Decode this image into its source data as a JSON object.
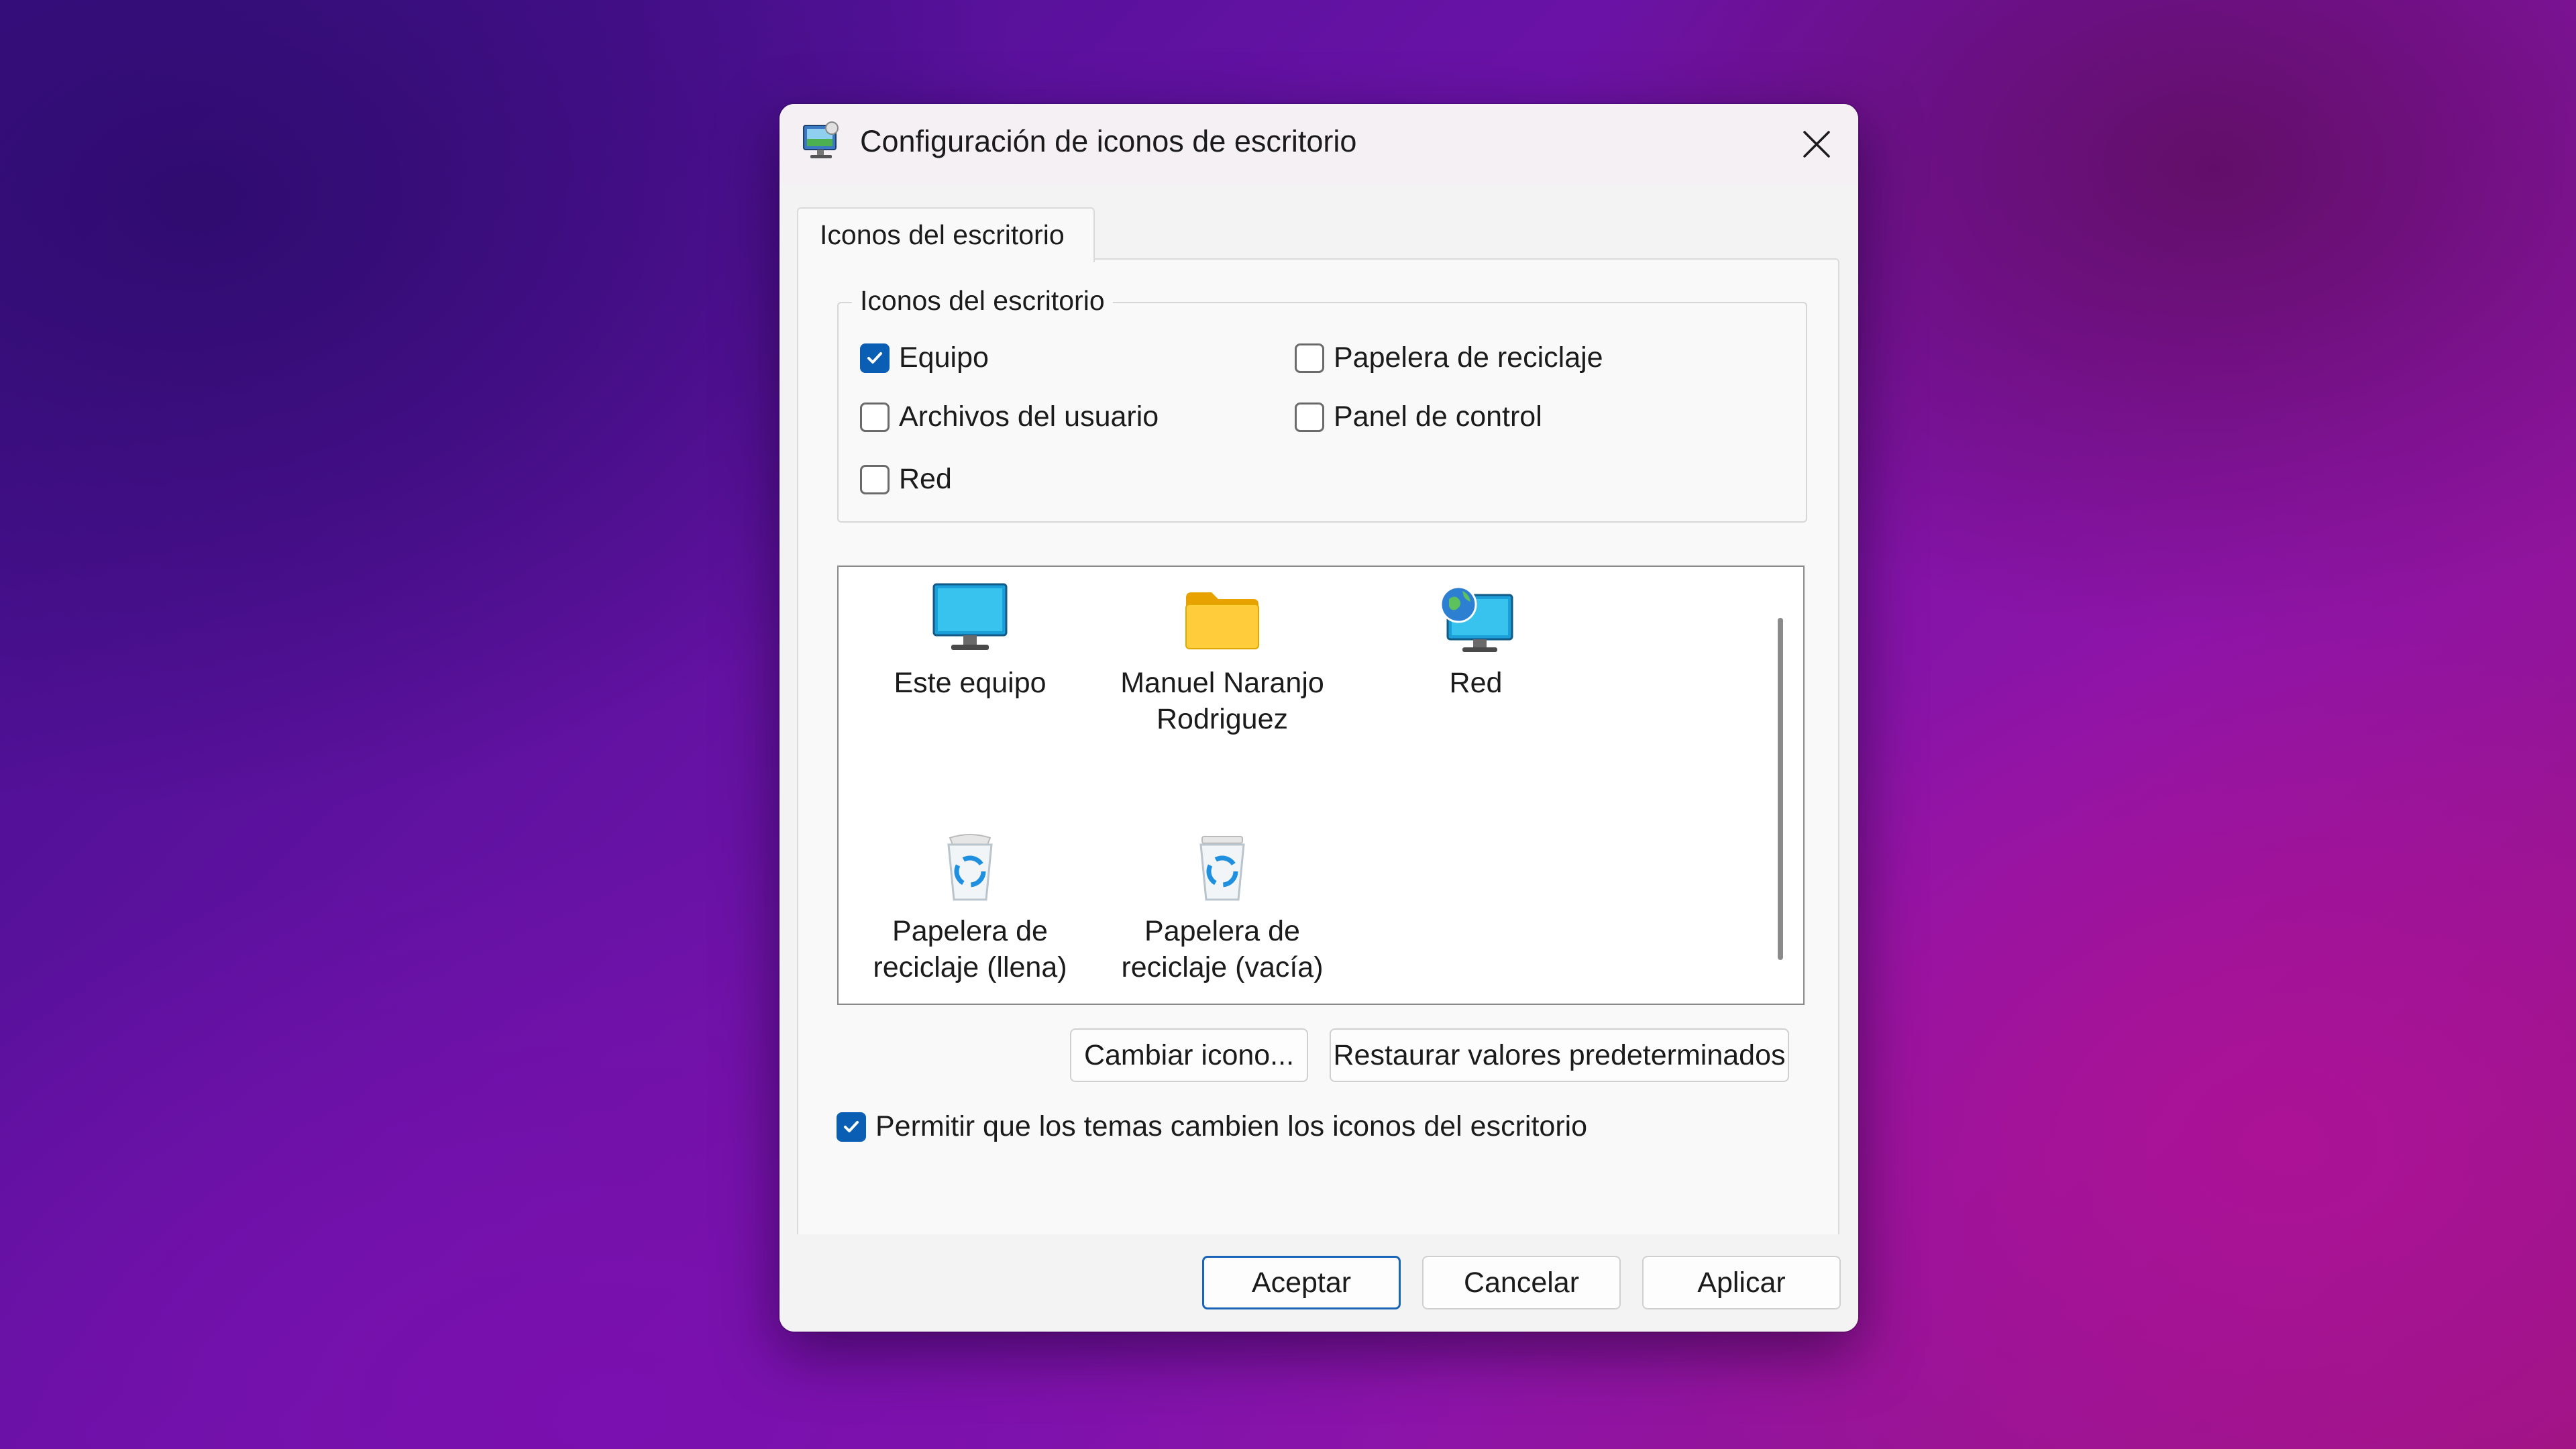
{
  "dialog": {
    "title": "Configuración de iconos de escritorio",
    "tab_label": "Iconos del escritorio"
  },
  "group": {
    "legend": "Iconos del escritorio",
    "checkboxes": [
      {
        "label": "Equipo",
        "checked": true
      },
      {
        "label": "Papelera de reciclaje",
        "checked": false
      },
      {
        "label": "Archivos del usuario",
        "checked": false
      },
      {
        "label": "Panel de control",
        "checked": false
      },
      {
        "label": "Red",
        "checked": false
      }
    ]
  },
  "icons": [
    {
      "line1": "Este equipo",
      "line2": "",
      "icon": "monitor-icon"
    },
    {
      "line1": "Manuel Naranjo",
      "line2": "Rodriguez",
      "icon": "folder-icon"
    },
    {
      "line1": "Red",
      "line2": "",
      "icon": "network-globe-icon"
    },
    {
      "line1": "Papelera de",
      "line2": "reciclaje (llena)",
      "icon": "recycle-bin-full-icon"
    },
    {
      "line1": "Papelera de",
      "line2": "reciclaje (vacía)",
      "icon": "recycle-bin-empty-icon"
    }
  ],
  "buttons": {
    "change_icon": "Cambiar icono...",
    "restore_defaults": "Restaurar valores predeterminados",
    "ok": "Aceptar",
    "cancel": "Cancelar",
    "apply": "Aplicar"
  },
  "theme_checkbox": {
    "label": "Permitir que los temas cambien los iconos del escritorio",
    "checked": true
  },
  "colors": {
    "accent": "#0a5fb4",
    "checkbox_border": "#6b6b6b"
  }
}
